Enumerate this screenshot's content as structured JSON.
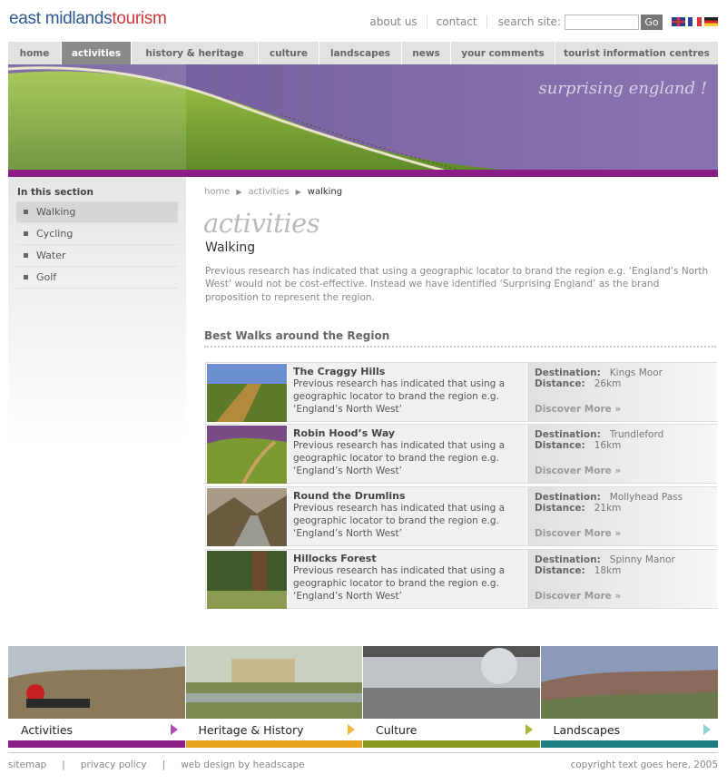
{
  "header": {
    "logo_part1": "east midlands",
    "logo_part2": "tourism",
    "links": [
      "about us",
      "contact"
    ],
    "search_label": "search site:",
    "search_placeholder": "",
    "go_label": "Go",
    "flags": [
      "uk-flag-icon",
      "france-flag-icon",
      "germany-flag-icon"
    ]
  },
  "nav": {
    "tabs": [
      {
        "label": "home",
        "active": false
      },
      {
        "label": "activities",
        "active": true
      },
      {
        "label": "history & heritage",
        "active": false
      },
      {
        "label": "culture",
        "active": false
      },
      {
        "label": "landscapes",
        "active": false
      },
      {
        "label": "news",
        "active": false
      },
      {
        "label": "your comments",
        "active": false
      },
      {
        "label": "tourist information centres",
        "active": false
      }
    ]
  },
  "banner": {
    "tagline": "surprising england !"
  },
  "sidebar": {
    "heading": "In this section",
    "items": [
      "Walking",
      "Cycling",
      "Water",
      "Golf"
    ],
    "selected": "Walking"
  },
  "breadcrumb": [
    "home",
    "activities",
    "walking"
  ],
  "main": {
    "section_title": "activities",
    "page_title": "Walking",
    "intro": "Previous research has indicated that using a geographic locator to brand the region e.g. ‘England’s North West’ would not be cost-effective.  Instead we have identified ‘Surprising England’ as the brand proposition to represent the region.",
    "walks_heading": "Best Walks around the Region"
  },
  "walks": [
    {
      "name": "The Craggy Hills",
      "desc": "Previous research has indicated that using a geographic locator to brand the region e.g. ‘England’s North West’",
      "destination_label": "Destination:",
      "destination": "Kings Moor",
      "distance_label": "Distance:",
      "distance": "26km",
      "link": "Discover More"
    },
    {
      "name": "Robin Hood’s Way",
      "desc": "Previous research has indicated that using a geographic locator to brand the region e.g. ‘England’s North West’",
      "destination_label": "Destination:",
      "destination": "Trundleford",
      "distance_label": "Distance:",
      "distance": "16km",
      "link": "Discover More"
    },
    {
      "name": "Round the Drumlins",
      "desc": "Previous research has indicated that using a geographic locator to brand the region e.g. ‘England’s North West’",
      "destination_label": "Destination:",
      "destination": "Mollyhead Pass",
      "distance_label": "Distance:",
      "distance": "21km",
      "link": "Discover More"
    },
    {
      "name": "Hillocks Forest",
      "desc": "Previous research has indicated that using a geographic locator to brand the region e.g. ‘England’s North West’",
      "destination_label": "Destination:",
      "destination": "Spinny Manor",
      "distance_label": "Distance:",
      "distance": "18km",
      "link": "Discover More"
    }
  ],
  "cards": [
    {
      "label": "Activities",
      "color": "#8b1d86",
      "arrow": "#b04cb0"
    },
    {
      "label": "Heritage & History",
      "color": "#e8a31d",
      "arrow": "#f0b840"
    },
    {
      "label": "Culture",
      "color": "#8a9a1e",
      "arrow": "#a9b832"
    },
    {
      "label": "Landscapes",
      "color": "#1e7f82",
      "arrow": "#8fcfd6"
    }
  ],
  "footer": {
    "links": [
      "sitemap",
      "privacy policy",
      "web design by headscape"
    ],
    "copyright": "copyright text goes here,  2005"
  },
  "colors": {
    "accent_purple": "#8b1d86",
    "logo_blue": "#2c5a93",
    "logo_red": "#cf3a3a"
  }
}
